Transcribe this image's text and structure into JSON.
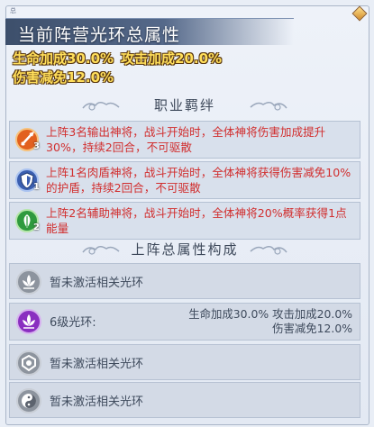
{
  "header": {
    "corner_tag": "总",
    "title": "当前阵营光环总属性"
  },
  "summary": {
    "line1_a": "生命加成30.0%",
    "line1_b": "攻击加成20.0%",
    "line2": "伤害减免12.0%"
  },
  "bonds_section": {
    "title": "职业羁绊",
    "items": [
      {
        "text": "上阵3名输出神将，战斗开始时，全体神将伤害加成提升30%，持续2回合，不可驱散",
        "badge": "3",
        "icon": "sword-icon",
        "color": "#e2611f"
      },
      {
        "text": "上阵1名肉盾神将，战斗开始时，全体神将获得伤害减免10%的护盾，持续2回合，不可驱散",
        "badge": "1",
        "icon": "shield-icon",
        "color": "#3b5fb0"
      },
      {
        "text": "上阵2名辅助神将，战斗开始时，全体神将20%概率获得1点能量",
        "badge": "2",
        "icon": "leaf-icon",
        "color": "#2f9a3e"
      }
    ]
  },
  "aura_section": {
    "title": "上阵总属性构成",
    "rows": [
      {
        "label": "暂未激活相关光环",
        "icon": "lotus-icon",
        "active": false
      },
      {
        "label": "6级光环:",
        "icon": "lotus-icon",
        "active": true,
        "value_line1": "生命加成30.0% 攻击加成20.0%",
        "value_line2": "伤害减免12.0%"
      },
      {
        "label": "暂未激活相关光环",
        "icon": "crest-icon",
        "active": false
      },
      {
        "label": "暂未激活相关光环",
        "icon": "yin-yang-icon",
        "active": false
      }
    ]
  },
  "colors": {
    "title_text": "#ffffff",
    "summary_text": "#ffde5a",
    "bond_text": "#d12e2e",
    "active_icon": "#8a2fc0"
  }
}
